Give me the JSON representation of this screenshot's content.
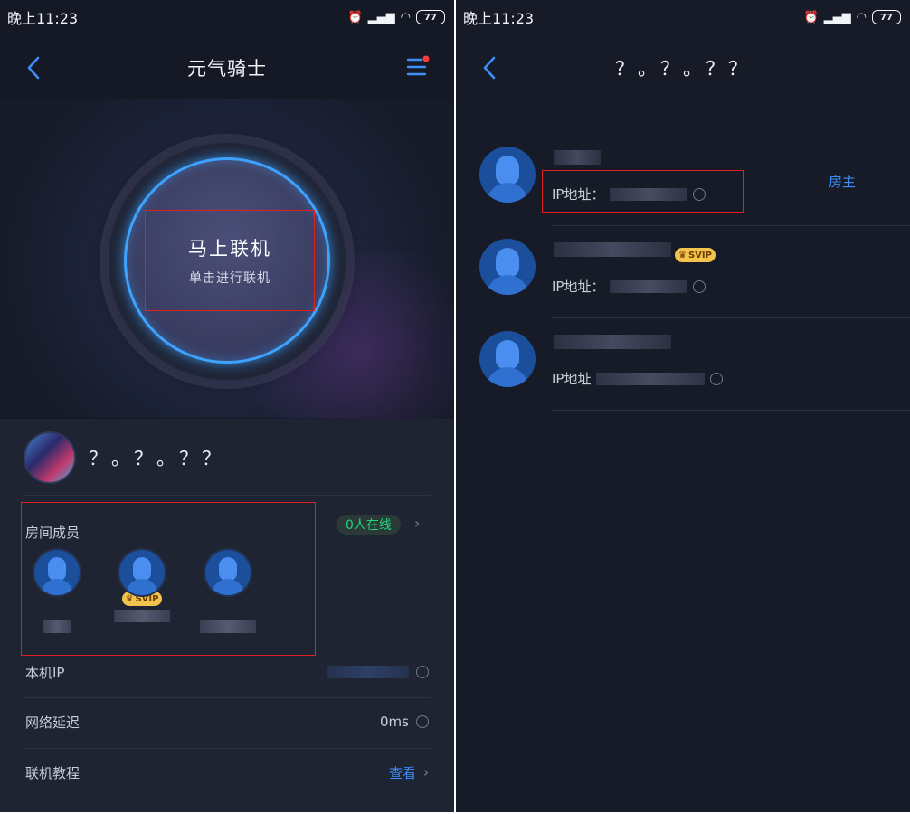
{
  "left": {
    "status": {
      "time": "晚上11:23",
      "battery": "77"
    },
    "nav": {
      "title": "元气骑士"
    },
    "connect": {
      "main_label": "马上联机",
      "sub_label": "单击进行联机"
    },
    "room": {
      "name": "？。？。？？",
      "members_label": "房间成员",
      "online_count": "0人在线",
      "members": [
        {
          "svip": false
        },
        {
          "svip": true,
          "badge": "SVIP"
        },
        {
          "svip": false
        }
      ],
      "rows": [
        {
          "label": "本机IP",
          "value": ""
        },
        {
          "label": "网络延迟",
          "value": "0ms"
        },
        {
          "label": "联机教程",
          "value": "查看"
        }
      ]
    }
  },
  "right": {
    "status": {
      "time": "晚上11:23",
      "battery": "77"
    },
    "nav": {
      "title": "？。？。？？"
    },
    "players": [
      {
        "ip_label": "IP地址：",
        "role": "房主",
        "svip": false
      },
      {
        "ip_label": "IP地址：",
        "role": "",
        "svip": true,
        "badge": "SVIP"
      },
      {
        "ip_label": "IP地址",
        "role": "",
        "svip": false
      }
    ]
  },
  "colors": {
    "accent_blue": "#3d8ef6",
    "online_green": "#21d37c",
    "highlight_red": "#e02020",
    "svip_gold": "#f4c34e"
  },
  "icons": [
    "back-chevron-icon",
    "menu-list-icon",
    "copy-icon",
    "refresh-icon",
    "chevron-right-icon",
    "crown-icon",
    "wifi-icon",
    "signal-icon",
    "battery-icon"
  ]
}
